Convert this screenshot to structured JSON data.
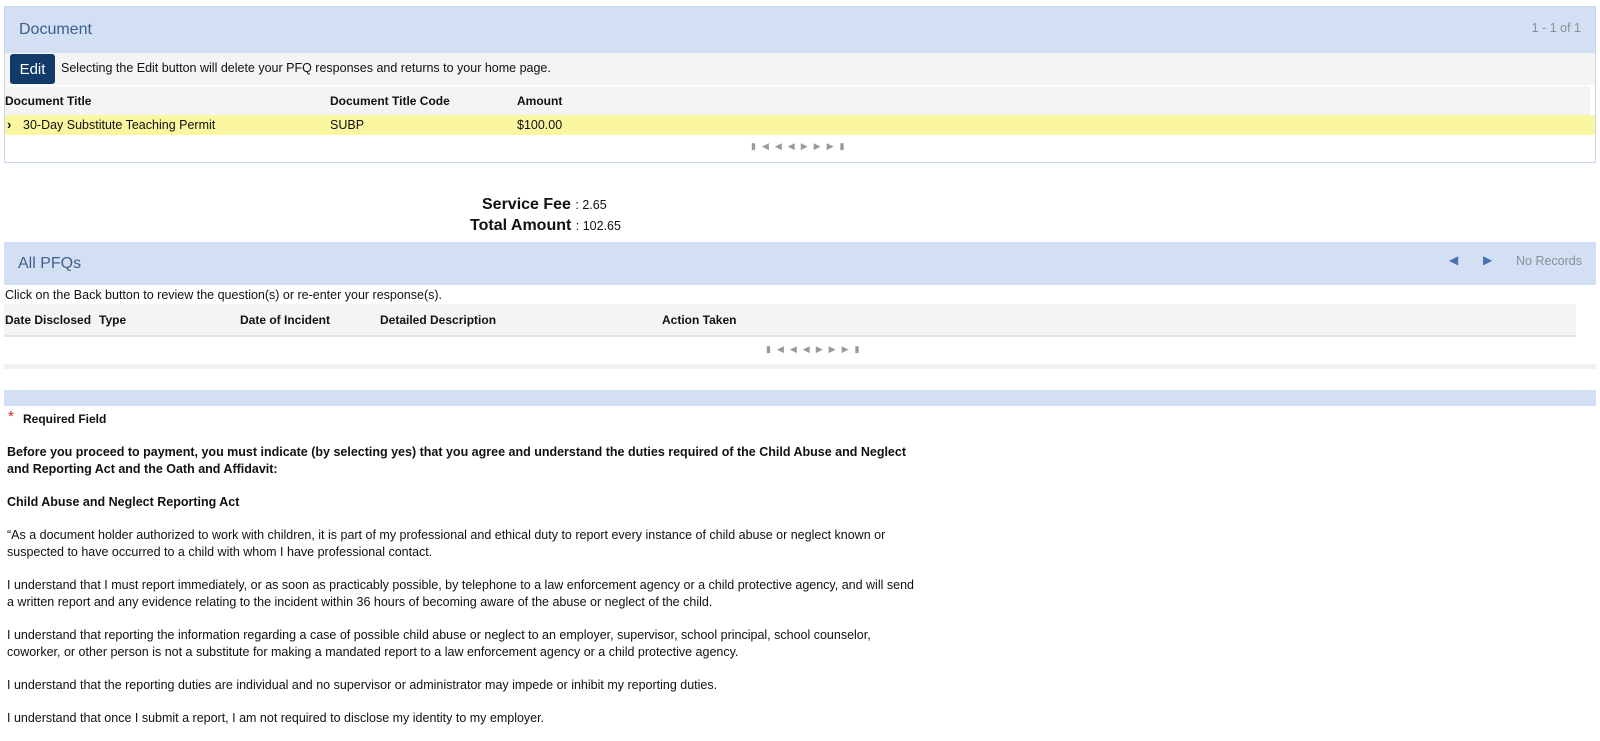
{
  "document_panel": {
    "title": "Document",
    "count": "1 - 1 of 1",
    "edit_label": "Edit",
    "edit_note": "Selecting the Edit button will delete your PFQ responses and returns to your home page.",
    "columns": [
      "Document Title",
      "Document Title Code",
      "Amount"
    ],
    "rows": [
      {
        "title": "30-Day Substitute Teaching Permit",
        "code": "SUBP",
        "amount": "$100.00"
      }
    ],
    "pager_icons": [
      "first-page-icon",
      "prev-page-icon",
      "next-page-icon",
      "last-page-icon"
    ],
    "highlight_color": "#fbf7a0"
  },
  "totals": {
    "service_fee_label": "Service Fee",
    "service_fee_value": ": 2.65",
    "total_amount_label": "Total Amount",
    "total_amount_value": ": 102.65"
  },
  "pfq_panel": {
    "title": "All PFQs",
    "status": "No Records",
    "note": "Click on the Back button to review the question(s) or re-enter your response(s).",
    "columns": [
      "Date Disclosed",
      "Type",
      "Date of Incident",
      "Detailed Description",
      "Action Taken"
    ]
  },
  "agreement": {
    "required_star": "*",
    "required_label": "Required Field",
    "intro": "Before you proceed to payment, you must indicate (by selecting yes) that you agree and understand the duties required of the Child Abuse and Neglect and Reporting Act and the Oath and Affidavit:",
    "act_heading": "Child Abuse and Neglect Reporting Act",
    "p1": "“As a document holder authorized to work with children, it is part of my professional and ethical duty to report every instance of child abuse or neglect known or suspected to have occurred to a child with whom I have professional contact.",
    "p2": "I understand that I must report immediately, or as soon as practicably possible, by telephone to a law enforcement agency or a child protective agency, and will send a written report and any evidence relating to the incident within 36 hours of becoming aware of the abuse or neglect of the child.",
    "p3": "I understand that reporting the information regarding a case of possible child abuse or neglect to an employer, supervisor, school principal, school counselor, coworker, or other person is not a substitute for making a mandated report to a law enforcement agency or a child protective agency.",
    "p4": "I understand that the reporting duties are individual and no supervisor or administrator may impede or inhibit my reporting duties.",
    "p5": "I understand that once I submit a report, I am not required to disclose my identity to my employer."
  },
  "colors": {
    "panel_header": "#d3dff3",
    "edit_button": "#113a6a",
    "title_text": "#3d5f8d",
    "required_star": "#dd2222"
  }
}
